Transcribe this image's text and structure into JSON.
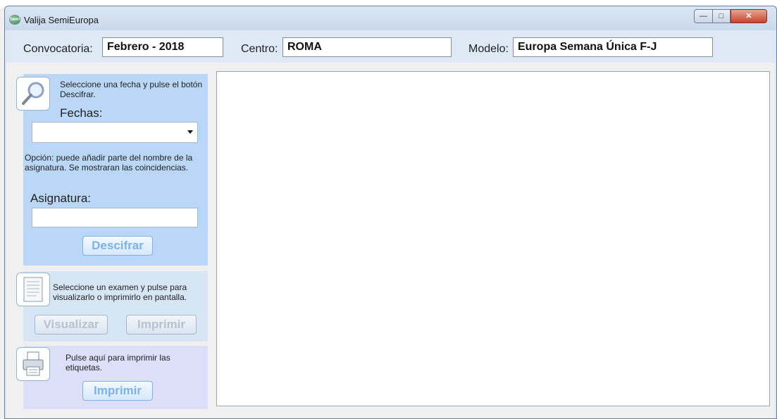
{
  "window": {
    "title": "Valija SemiEuropa",
    "app_icon_text": "Semi"
  },
  "info": {
    "convocatoria_label": "Convocatoria:",
    "convocatoria_value": "Febrero - 2018",
    "centro_label": "Centro:",
    "centro_value": "ROMA",
    "modelo_label": "Modelo:",
    "modelo_value": "Europa Semana Única F-J"
  },
  "decrypt_panel": {
    "instructions": "Seleccione una fecha  y pulse el botón Descifrar.",
    "fechas_label": "Fechas:",
    "fechas_value": "",
    "option_text": "Opción: puede añadir parte del nombre de la asignatura. Se mostraran las coincidencias.",
    "asignatura_label": "Asignatura:",
    "asignatura_value": "",
    "descifrar_button": "Descifrar"
  },
  "exam_panel": {
    "instructions": "Seleccione un examen y pulse para visualizarlo o imprimirlo  en pantalla.",
    "visualizar_button": "Visualizar",
    "imprimir_button": "Imprimir"
  },
  "labels_panel": {
    "instructions": "Pulse aquí para imprimir las etiquetas.",
    "imprimir_button": "Imprimir"
  },
  "colors": {
    "decrypt_panel_bg": "#bad7f7",
    "exam_panel_bg": "#d6e6f5",
    "labels_panel_bg": "#dcdff7",
    "active_button_text": "#79b2ef",
    "disabled_button_text": "#b5c2d2"
  }
}
